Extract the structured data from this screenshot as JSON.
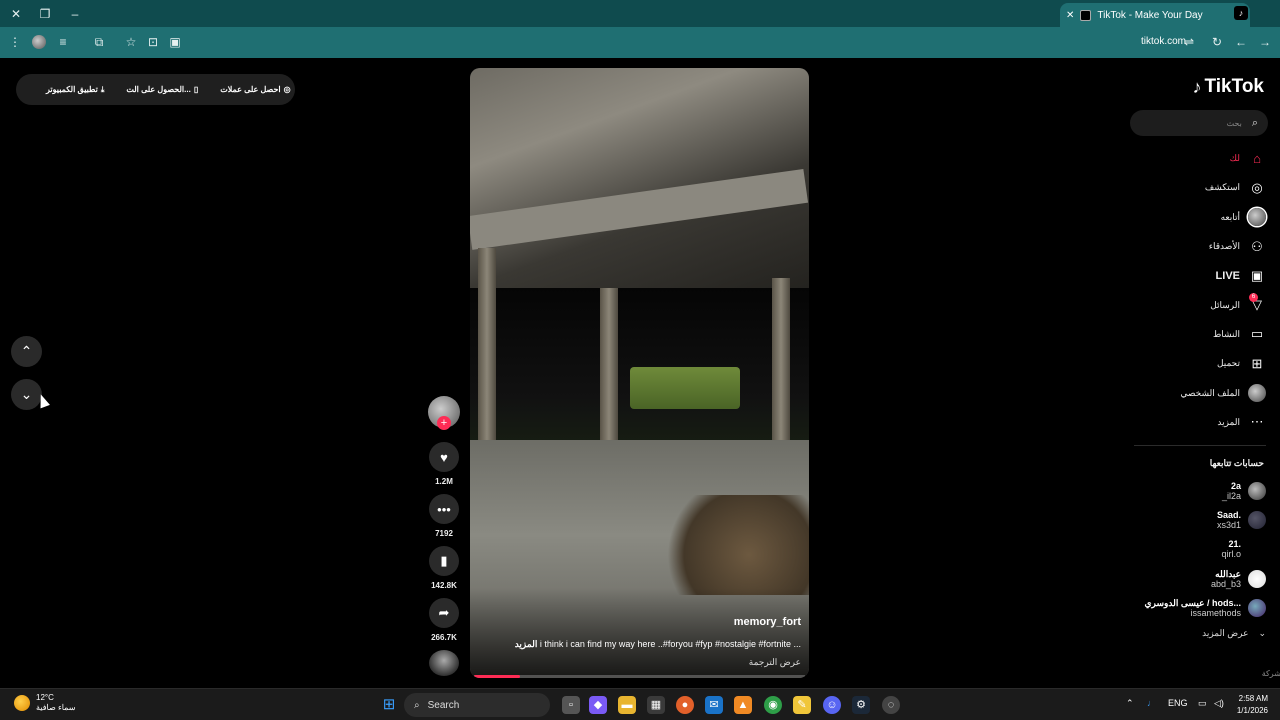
{
  "browser": {
    "tab_title": "TikTok - Make Your Day",
    "url": "tiktok.com"
  },
  "topbar": {
    "get_coins": "احصل على عملات",
    "get_app": "الحصول على الت...",
    "desktop_app": "تطبيق الكمبيوتر"
  },
  "video": {
    "author": "memory_fort",
    "description": "i think i can find my way here ..#foryou #fyp #nostalgie #fortnite ...",
    "more": "المزيد",
    "translate": "عرض الترجمة",
    "progress_percent": 14
  },
  "actions": {
    "likes": "1.2M",
    "comments": "7192",
    "saves": "142.8K",
    "shares": "266.7K"
  },
  "sidebar": {
    "logo": "TikTok",
    "search_placeholder": "بحث",
    "menu": [
      {
        "label": "لك",
        "icon": "home-icon"
      },
      {
        "label": "استكشف",
        "icon": "compass-icon"
      },
      {
        "label": "أتابعه",
        "icon": "following-icon"
      },
      {
        "label": "الأصدقاء",
        "icon": "friends-icon"
      },
      {
        "label": "LIVE",
        "icon": "live-icon"
      },
      {
        "label": "الرسائل",
        "icon": "send-icon",
        "badge": "6"
      },
      {
        "label": "النشاط",
        "icon": "activity-icon"
      },
      {
        "label": "تحميل",
        "icon": "upload-icon"
      },
      {
        "label": "الملف الشخصي",
        "icon": "profile-icon"
      },
      {
        "label": "المزيد",
        "icon": "more-icon"
      }
    ],
    "following_header": "حسابات تتابعها",
    "following": [
      {
        "name": "2a",
        "handle": "_il2a"
      },
      {
        "name": "Saad.",
        "handle": "xs3d1"
      },
      {
        "name": "21.",
        "handle": "qirl.o"
      },
      {
        "name": "عبدالله",
        "handle": "abd_b3"
      },
      {
        "name": "عيسى الدوسري / hods...",
        "handle": "issamethods"
      }
    ],
    "show_more": "عرض المزيد",
    "company": "الشركة"
  },
  "taskbar": {
    "temperature": "12°C",
    "weather": "سماء صافية",
    "search": "Search",
    "lang": "ENG",
    "time": "2:58 AM",
    "date": "1/1/2026"
  },
  "colors": {
    "accent": "#fe2c55",
    "titlebar": "#0f4b4e",
    "addressbar": "#1f6f72"
  }
}
